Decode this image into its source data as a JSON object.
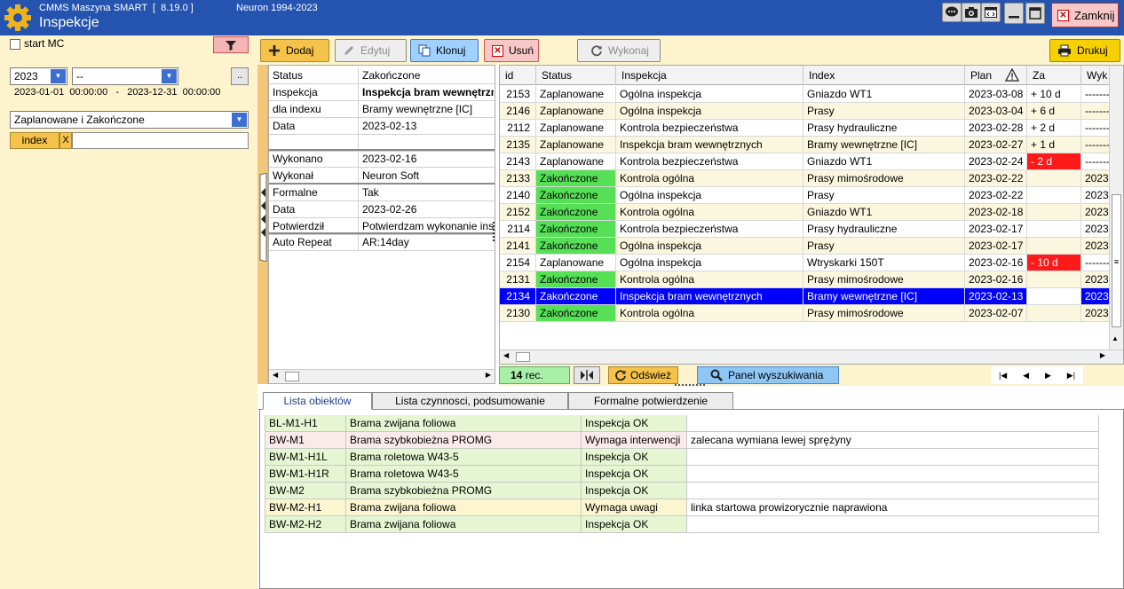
{
  "titlebar": {
    "app": "CMMS Maszyna SMART  [  8.19.0 ]",
    "page_title": "Inspekcje",
    "copyright": "Neuron 1994-2023",
    "close_label": "Zamknij"
  },
  "left": {
    "start_mc_label": "start MC",
    "year": "2023",
    "period": "--",
    "more_label": "..",
    "date_range": "2023-01-01  00:00:00   -   2023-12-31  00:00:00",
    "status_filter": "Zaplanowane i Zakończone",
    "index_label": "index",
    "index_clear": "X",
    "index_value": ""
  },
  "toolbar": {
    "add": "Dodaj",
    "edit": "Edytuj",
    "clone": "Klonuj",
    "delete": "Usuń",
    "execute": "Wykonaj",
    "print": "Drukuj"
  },
  "details": [
    {
      "k": "Status",
      "v": "Zakończone"
    },
    {
      "k": "Inspekcja",
      "v": "Inspekcja bram wewnętrznych"
    },
    {
      "k": "dla indexu",
      "v": "Bramy wewnętrzne [IC]"
    },
    {
      "k": "Data",
      "v": "2023-02-13"
    },
    {
      "k": "",
      "v": ""
    },
    {
      "k": "Wykonano",
      "v": "2023-02-16"
    },
    {
      "k": "Wykonał",
      "v": "Neuron Soft"
    },
    {
      "k": "Formalne",
      "v": "Tak"
    },
    {
      "k": "Data",
      "v": "2023-02-26"
    },
    {
      "k": "Potwierdził",
      "v": "Potwierdzam wykonanie inspekcji"
    },
    {
      "k": "Auto Repeat",
      "v": "AR:14day"
    }
  ],
  "grid": {
    "columns": [
      "id",
      "Status",
      "Inspekcja",
      "Index",
      "Plan",
      "Za",
      "Wyk"
    ],
    "rows": [
      {
        "id": "2153",
        "status": "Zaplanowane",
        "insp": "Ogólna inspekcja",
        "index": "Gniazdo WT1",
        "plan": "2023-03-08",
        "za": "+ 10 d",
        "wyk": "--------"
      },
      {
        "id": "2146",
        "status": "Zaplanowane",
        "insp": "Ogólna inspekcja",
        "index": "Prasy",
        "plan": "2023-03-04",
        "za": "+ 6 d",
        "wyk": "--------"
      },
      {
        "id": "2112",
        "status": "Zaplanowane",
        "insp": "Kontrola bezpieczeństwa",
        "index": "Prasy hydrauliczne",
        "plan": "2023-02-28",
        "za": "+ 2 d",
        "wyk": "--------"
      },
      {
        "id": "2135",
        "status": "Zaplanowane",
        "insp": "Inspekcja bram wewnętrznych",
        "index": "Bramy wewnętrzne [IC]",
        "plan": "2023-02-27",
        "za": "+ 1 d",
        "wyk": "--------"
      },
      {
        "id": "2143",
        "status": "Zaplanowane",
        "insp": "Kontrola bezpieczeństwa",
        "index": "Gniazdo WT1",
        "plan": "2023-02-24",
        "za": "- 2 d",
        "wyk": "--------"
      },
      {
        "id": "2133",
        "status": "Zakończone",
        "insp": "Kontrola ogólna",
        "index": "Prasy mimośrodowe",
        "plan": "2023-02-22",
        "za": "",
        "wyk": "2023"
      },
      {
        "id": "2140",
        "status": "Zakończone",
        "insp": "Ogólna inspekcja",
        "index": "Prasy",
        "plan": "2023-02-22",
        "za": "",
        "wyk": "2023"
      },
      {
        "id": "2152",
        "status": "Zakończone",
        "insp": "Kontrola ogólna",
        "index": "Gniazdo WT1",
        "plan": "2023-02-18",
        "za": "",
        "wyk": "2023"
      },
      {
        "id": "2114",
        "status": "Zakończone",
        "insp": "Kontrola bezpieczeństwa",
        "index": "Prasy hydrauliczne",
        "plan": "2023-02-17",
        "za": "",
        "wyk": "2023"
      },
      {
        "id": "2141",
        "status": "Zakończone",
        "insp": "Ogólna inspekcja",
        "index": "Prasy",
        "plan": "2023-02-17",
        "za": "",
        "wyk": "2023"
      },
      {
        "id": "2154",
        "status": "Zaplanowane",
        "insp": "Ogólna inspekcja",
        "index": "Wtryskarki 150T",
        "plan": "2023-02-16",
        "za": "- 10 d",
        "wyk": "--------"
      },
      {
        "id": "2131",
        "status": "Zakończone",
        "insp": "Kontrola ogólna",
        "index": "Prasy mimośrodowe",
        "plan": "2023-02-16",
        "za": "",
        "wyk": "2023"
      },
      {
        "id": "2134",
        "status": "Zakończone",
        "insp": "Inspekcja bram wewnętrznych",
        "index": "Bramy wewnętrzne [IC]",
        "plan": "2023-02-13",
        "za": "",
        "wyk": "2023"
      },
      {
        "id": "2130",
        "status": "Zakończone",
        "insp": "Kontrola ogólna",
        "index": "Prasy mimośrodowe",
        "plan": "2023-02-07",
        "za": "",
        "wyk": "2023"
      }
    ],
    "selected_id": "2134",
    "scroll_thumb_glyph": "≡"
  },
  "statusbar": {
    "record_count": "14",
    "record_unit": "rec.",
    "refresh": "Odśwież",
    "search_panel": "Panel wyszukiwania"
  },
  "tabs": [
    "Lista obiektów",
    "Lista czynnosci, podsumowanie",
    "Formalne potwierdzenie"
  ],
  "objects": [
    {
      "code": "BL-M1-H1",
      "name": "Brama zwijana foliowa",
      "result": "Inspekcja OK",
      "note": ""
    },
    {
      "code": "BW-M1",
      "name": "Brama szybkobieżna  PROMG",
      "result": "Wymaga interwencji",
      "note": "zalecana wymiana lewej sprężyny"
    },
    {
      "code": "BW-M1-H1L",
      "name": "Brama roletowa W43-5",
      "result": "Inspekcja OK",
      "note": ""
    },
    {
      "code": "BW-M1-H1R",
      "name": "Brama roletowa W43-5",
      "result": "Inspekcja OK",
      "note": ""
    },
    {
      "code": "BW-M2",
      "name": "Brama szybkobieżna  PROMG",
      "result": "Inspekcja OK",
      "note": ""
    },
    {
      "code": "BW-M2-H1",
      "name": "Brama zwijana foliowa",
      "result": "Wymaga uwagi",
      "note": "linka startowa prowizorycznie naprawiona"
    },
    {
      "code": "BW-M2-H2",
      "name": "Brama zwijana foliowa",
      "result": "Inspekcja OK",
      "note": ""
    }
  ],
  "colors": {
    "titlebar": "#2553b0",
    "panel_bg": "#fdf3cc",
    "done": "#55e055",
    "overdue": "#ff1a1a",
    "selected": "#0000ff"
  }
}
